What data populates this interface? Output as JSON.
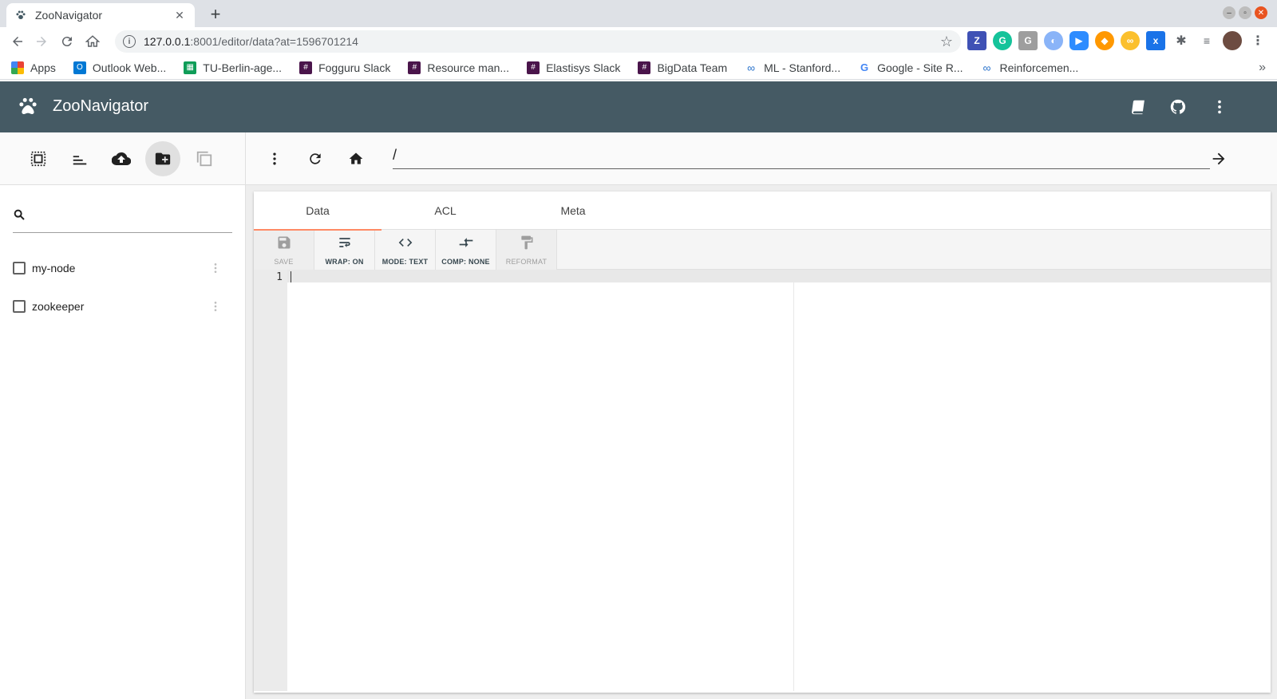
{
  "browser": {
    "tab_title": "ZooNavigator",
    "url_host": "127.0.0.1",
    "url_rest": ":8001/editor/data?at=1596701214",
    "bookmarks": [
      {
        "label": "Apps",
        "icon": "apps-grid-icon",
        "color": "#ea4335"
      },
      {
        "label": "Outlook Web...",
        "icon": "outlook-icon",
        "color": "#0078d4"
      },
      {
        "label": "TU-Berlin-age...",
        "icon": "sheets-icon",
        "color": "#0f9d58"
      },
      {
        "label": "Fogguru Slack",
        "icon": "slack-icon",
        "color": "#4a154b"
      },
      {
        "label": "Resource man...",
        "icon": "slack-icon",
        "color": "#4a154b"
      },
      {
        "label": "Elastisys Slack",
        "icon": "slack-icon",
        "color": "#4a154b"
      },
      {
        "label": "BigData Team",
        "icon": "slack-icon",
        "color": "#4a154b"
      },
      {
        "label": "ML - Stanford...",
        "icon": "coursera-icon",
        "color": "#2a73cc"
      },
      {
        "label": "Google - Site R...",
        "icon": "google-icon",
        "color": "#4285f4"
      },
      {
        "label": "Reinforcemen...",
        "icon": "coursera-icon",
        "color": "#2a73cc"
      }
    ]
  },
  "app": {
    "title": "ZooNavigator",
    "header_color": "#455a64"
  },
  "sidebar": {
    "search_placeholder": "",
    "nodes": [
      {
        "name": "my-node"
      },
      {
        "name": "zookeeper"
      }
    ]
  },
  "pathbar": {
    "path": "/"
  },
  "editor": {
    "tabs": [
      {
        "label": "Data",
        "active": true
      },
      {
        "label": "ACL",
        "active": false
      },
      {
        "label": "Meta",
        "active": false
      }
    ],
    "tools": {
      "save": "SAVE",
      "wrap": "WRAP: ON",
      "mode": "MODE: TEXT",
      "comp": "COMP: NONE",
      "reformat": "REFORMAT"
    },
    "line_number": "1",
    "accent_color": "#ff8a65"
  }
}
